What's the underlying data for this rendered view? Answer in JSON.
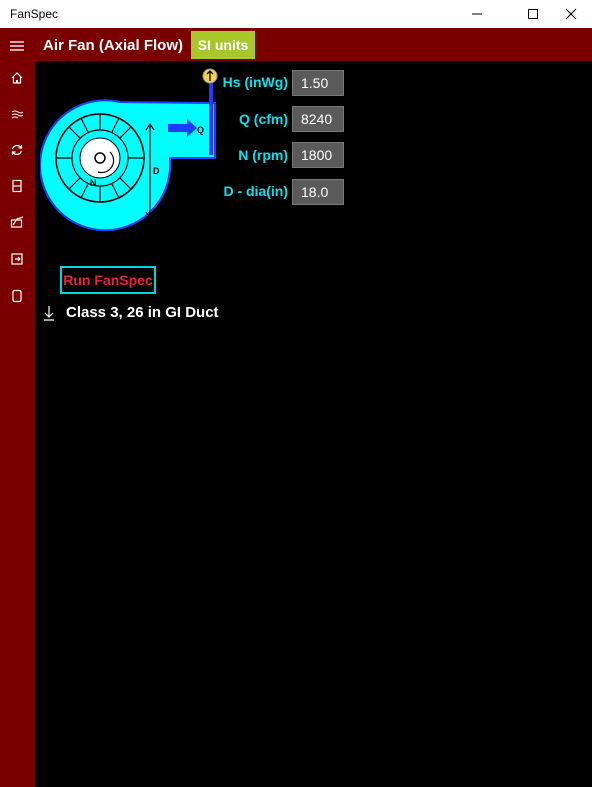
{
  "window": {
    "title": "FanSpec"
  },
  "header": {
    "title": "Air Fan (Axial Flow)",
    "units_button": "SI units"
  },
  "sidebar": {
    "items": [
      "menu-icon",
      "home-icon",
      "wave-icon",
      "refresh-icon",
      "layout-icon",
      "chart-icon",
      "export-icon",
      "tablet-icon"
    ]
  },
  "params": [
    {
      "label": "Hs (inWg)",
      "value": "1.50"
    },
    {
      "label": "Q (cfm)",
      "value": "8240"
    },
    {
      "label": "N (rpm)",
      "value": "1800"
    },
    {
      "label": "D - dia(in)",
      "value": "18.0"
    }
  ],
  "diagram": {
    "q_label": "Q",
    "n_label": "N",
    "d_label": "D"
  },
  "run_button": "Run FanSpec",
  "result": "Class 3, 26 in GI Duct",
  "colors": {
    "accent": "#7a0000",
    "si": "#a8c82a",
    "cyan": "#00e5ee",
    "run_text": "#e8213f"
  }
}
